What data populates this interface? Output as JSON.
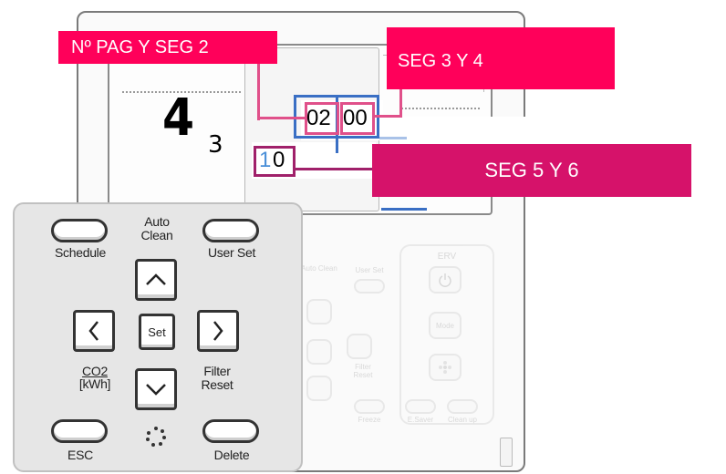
{
  "display": {
    "page_number": "4",
    "segment_1": "3",
    "segment_2_value": "02",
    "segment_3_4_value": "00",
    "segment_5_6_digit1": "1",
    "segment_5_6_digit2": "0"
  },
  "annotations": {
    "label_page_seg2": "Nº PAG Y SEG 2",
    "label_seg34": "SEG 3 Y 4",
    "label_seg56": "SEG 5 Y 6"
  },
  "keypad": {
    "auto_clean": "Auto Clean",
    "schedule": "Schedule",
    "user_set": "User Set",
    "set": "Set",
    "co2_top": "CO2",
    "co2_bottom": "[kWh]",
    "filter_reset": "Filter Reset",
    "esc": "ESC",
    "delete": "Delete"
  },
  "faded_panel": {
    "erv": "ERV",
    "mode": "Mode",
    "esaver": "E.Saver",
    "clean_up": "Clean up",
    "freeze": "Freeze",
    "user_set": "User Set",
    "auto_clean": "Auto Clean",
    "filter_reset": "Filter Reset"
  },
  "colors": {
    "annotation_pink": "#ff005a",
    "annotation_magenta": "#d6126a",
    "outline_blue": "#3a6fc4",
    "outline_pink": "#e0508a",
    "outline_purple": "#a0206a"
  },
  "icons": [
    "arrow-up-icon",
    "arrow-down-icon",
    "arrow-left-icon",
    "arrow-right-icon",
    "power-icon",
    "fan-icon",
    "dots-circle-icon"
  ]
}
